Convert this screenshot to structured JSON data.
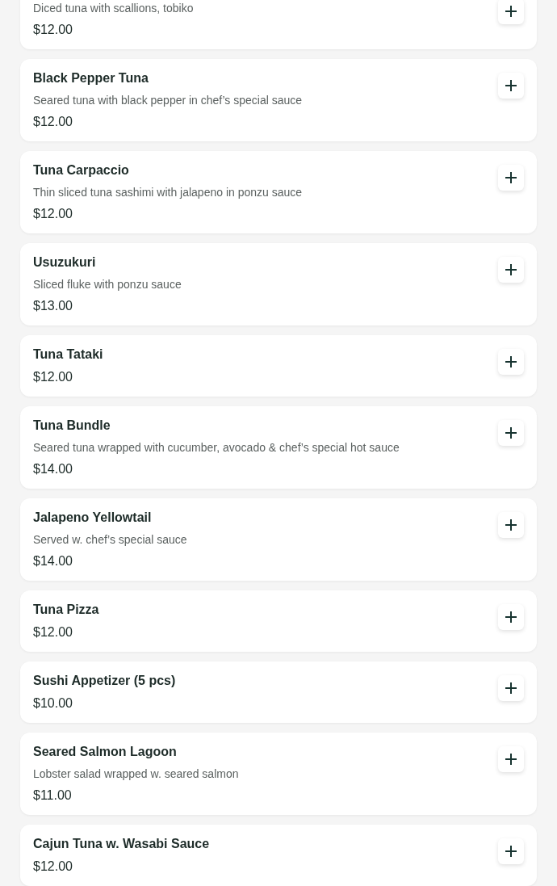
{
  "items": [
    {
      "description": "Diced tuna with scallions, tobiko",
      "price": "$12.00"
    },
    {
      "name": "Black Pepper Tuna",
      "description": "Seared tuna with black pepper in chef’s special sauce",
      "price": "$12.00"
    },
    {
      "name": "Tuna Carpaccio",
      "description": "Thin sliced tuna sashimi with jalapeno in ponzu sauce",
      "price": "$12.00"
    },
    {
      "name": "Usuzukuri",
      "description": "Sliced fluke with ponzu sauce",
      "price": "$13.00"
    },
    {
      "name": "Tuna Tataki",
      "price": "$12.00"
    },
    {
      "name": "Tuna Bundle",
      "description": "Seared tuna wrapped with cucumber, avocado & chef’s special hot sauce",
      "price": "$14.00"
    },
    {
      "name": "Jalapeno Yellowtail",
      "description": "Served w. chef’s special sauce",
      "price": "$14.00"
    },
    {
      "name": "Tuna Pizza",
      "price": "$12.00"
    },
    {
      "name": "Sushi Appetizer (5 pcs)",
      "price": "$10.00"
    },
    {
      "name": "Seared Salmon Lagoon",
      "description": "Lobster salad wrapped w. seared salmon",
      "price": "$11.00"
    },
    {
      "name": "Cajun Tuna w. Wasabi Sauce",
      "price": "$12.00"
    }
  ]
}
